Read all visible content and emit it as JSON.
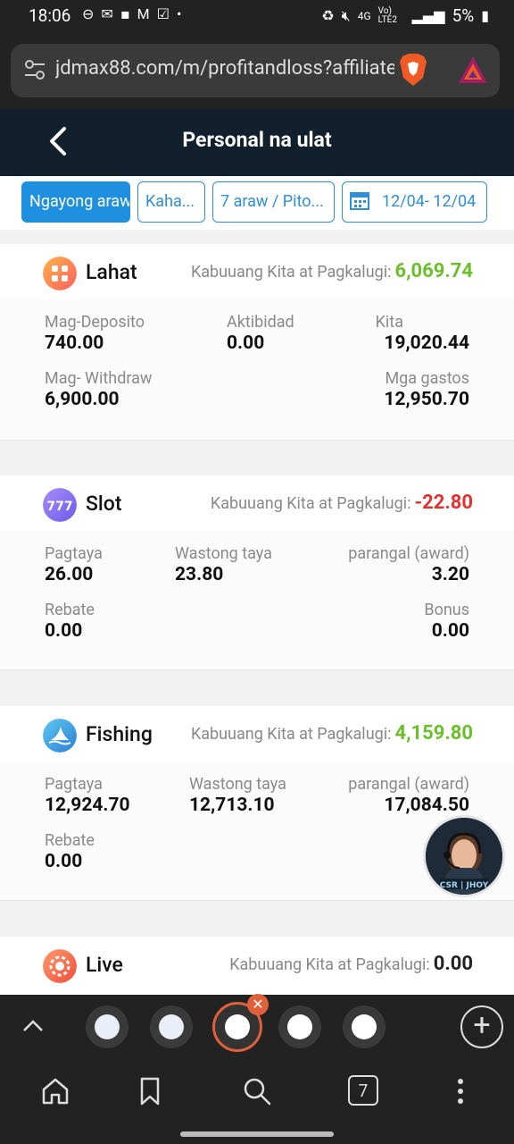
{
  "status_bar": {
    "time": "18:06",
    "network": "4G",
    "volte": "Vo) LTE2",
    "battery": "5%"
  },
  "browser": {
    "url": "jdmax88.com/m/profitandloss?affiliate",
    "tab_count": "7"
  },
  "header": {
    "title": "Personal na ulat"
  },
  "filters": [
    {
      "label": "Ngayong araw",
      "active": true
    },
    {
      "label": "Kaha...",
      "active": false
    },
    {
      "label": "7 araw / Pito...",
      "active": false
    },
    {
      "label": "12/04- 12/04",
      "active": false
    }
  ],
  "summary_label": "Kabuuang Kita at Pagkalugi:",
  "cards": {
    "lahat": {
      "name": "Lahat",
      "total": "6,069.74",
      "deposit_label": "Mag-Deposito",
      "deposit_value": "740.00",
      "activity_label": "Aktibidad",
      "activity_value": "0.00",
      "income_label": "Kita",
      "income_value": "19,020.44",
      "withdraw_label": "Mag- Withdraw",
      "withdraw_value": "6,900.00",
      "expense_label": "Mga gastos",
      "expense_value": "12,950.70"
    },
    "slot": {
      "name": "Slot",
      "total": "-22.80",
      "bet_label": "Pagtaya",
      "bet_value": "26.00",
      "valid_label": "Wastong taya",
      "valid_value": "23.80",
      "award_label": "parangal (award)",
      "award_value": "3.20",
      "rebate_label": "Rebate",
      "rebate_value": "0.00",
      "bonus_label": "Bonus",
      "bonus_value": "0.00"
    },
    "fishing": {
      "name": "Fishing",
      "total": "4,159.80",
      "bet_label": "Pagtaya",
      "bet_value": "12,924.70",
      "valid_label": "Wastong taya",
      "valid_value": "12,713.10",
      "award_label": "parangal (award)",
      "award_value": "17,084.50",
      "rebate_label": "Rebate",
      "rebate_value": "0.00"
    },
    "live": {
      "name": "Live",
      "total": "0.00"
    }
  },
  "support": {
    "badge": "CSR | JHOY"
  }
}
